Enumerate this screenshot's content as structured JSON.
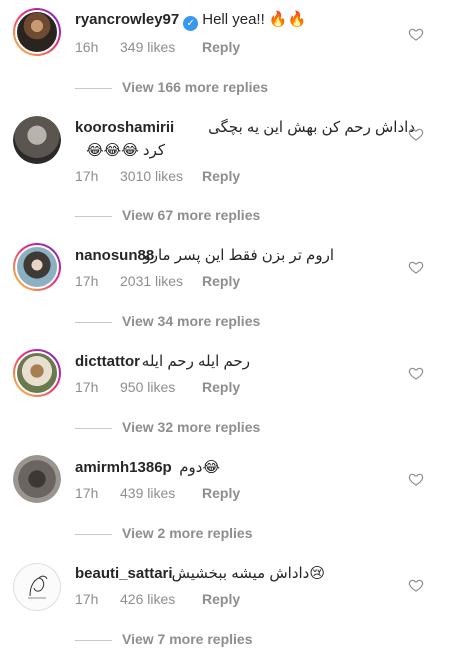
{
  "comments": [
    {
      "username": "ryancrowley97",
      "verified": true,
      "text": "Hell yea!! 🔥🔥",
      "time": "16h",
      "likes": "349 likes",
      "reply": "Reply",
      "view_replies": "View 166 more replies",
      "avatar": "avatar-ryancrowley97"
    },
    {
      "username": "kooroshamirii",
      "verified": false,
      "text_line1": "داداش رحم کن بهش این یه بچگی",
      "text_line2": "کرد 😂😂😂",
      "time": "17h",
      "likes": "3010 likes",
      "reply": "Reply",
      "view_replies": "View 67 more replies",
      "avatar": "avatar-kooroshamirii"
    },
    {
      "username": "nanosun88",
      "verified": false,
      "text": "اروم تر بزن فقط این پسر مارو",
      "time": "17h",
      "likes": "2031 likes",
      "reply": "Reply",
      "view_replies": "View 34 more replies",
      "avatar": "avatar-nanosun88"
    },
    {
      "username": "dicttattor",
      "verified": false,
      "text": "رحم ایله رحم ایله",
      "time": "17h",
      "likes": "950 likes",
      "reply": "Reply",
      "view_replies": "View 32 more replies",
      "avatar": "avatar-dicttattor"
    },
    {
      "username": "amirmh1386p",
      "verified": false,
      "text": "😂دوم",
      "time": "17h",
      "likes": "439 likes",
      "reply": "Reply",
      "view_replies": "View 2 more replies",
      "avatar": "avatar-amirmh1386p"
    },
    {
      "username": "beauti_sattari",
      "verified": false,
      "text": "😢داداش میشه ببخشیش",
      "time": "17h",
      "likes": "426 likes",
      "reply": "Reply",
      "view_replies": "View 7 more replies",
      "avatar": "avatar-beauti_sattari"
    }
  ],
  "icons": {
    "like": "heart-outline-icon",
    "verified": "verified-badge-icon"
  },
  "colors": {
    "text": "#262626",
    "secondary": "#8e8e8e",
    "verified": "#3897f0",
    "divider": "#c7c7c7"
  }
}
